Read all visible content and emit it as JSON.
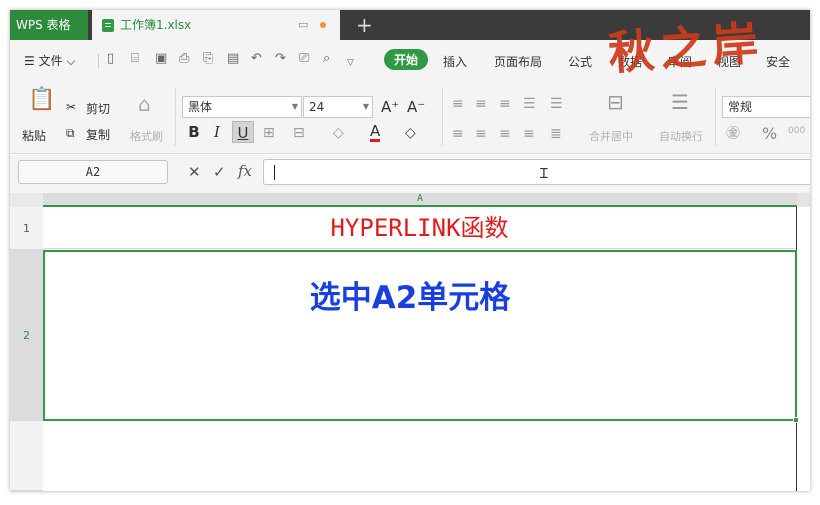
{
  "app": {
    "name": "WPS 表格",
    "doc_name": "工作簿1.xlsx",
    "new_tab": "+"
  },
  "menu": {
    "file": "☰ 文件 ⌵",
    "tabs": [
      "开始",
      "插入",
      "页面布局",
      "公式",
      "数据",
      "审阅",
      "视图",
      "安全"
    ],
    "active_tab": "开始"
  },
  "ribbon": {
    "paste": "粘贴",
    "cut": "剪切",
    "copy": "复制",
    "format_painter": "格式刷",
    "font_name": "黑体",
    "font_size": "24",
    "bold": "B",
    "italic": "I",
    "underline": "U",
    "merge_center": "合并居中",
    "wrap_text": "自动换行",
    "number_format": "常规",
    "grow_font": "A⁺",
    "shrink_font": "A⁻",
    "font_color": "A",
    "percent": "%"
  },
  "formula_bar": {
    "name_box": "A2",
    "cancel": "✕",
    "confirm": "✓",
    "fx": "fx",
    "formula": ""
  },
  "sheet": {
    "column_header": "A",
    "rows": [
      {
        "header": "1",
        "value": "HYPERLINK函数"
      },
      {
        "header": "2",
        "value": ""
      },
      {
        "header": "",
        "value": ""
      }
    ],
    "selected_cell": "A2"
  },
  "caption": "选中A2单元格",
  "watermark": "秋之岸",
  "colors": {
    "accent": "#2e9b44",
    "title_text": "#e01b1b",
    "caption": "#1a3fdc",
    "watermark": "#cc3a1a"
  }
}
